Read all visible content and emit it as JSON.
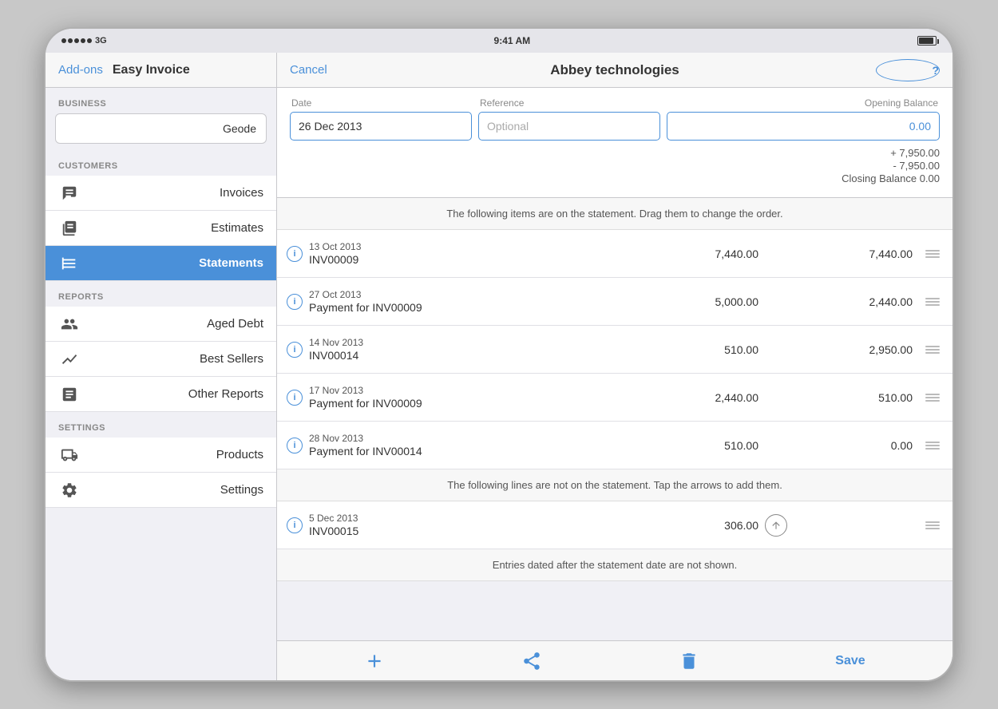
{
  "statusBar": {
    "signal": "●●●●●",
    "network": "3G",
    "time": "9:41 AM"
  },
  "sidebar": {
    "addonsLabel": "Add-ons",
    "appTitle": "Easy Invoice",
    "sections": {
      "business": {
        "label": "BUSINESS",
        "currentBusiness": "Geode"
      },
      "customers": {
        "label": "CUSTOMERS",
        "items": [
          {
            "id": "invoices",
            "label": "Invoices"
          },
          {
            "id": "estimates",
            "label": "Estimates"
          },
          {
            "id": "statements",
            "label": "Statements",
            "active": true
          }
        ]
      },
      "reports": {
        "label": "REPORTS",
        "items": [
          {
            "id": "aged-debt",
            "label": "Aged Debt"
          },
          {
            "id": "best-sellers",
            "label": "Best Sellers"
          },
          {
            "id": "other-reports",
            "label": "Other Reports"
          }
        ]
      },
      "settings": {
        "label": "SETTINGS",
        "items": [
          {
            "id": "products",
            "label": "Products"
          },
          {
            "id": "settings",
            "label": "Settings"
          }
        ]
      }
    }
  },
  "header": {
    "cancelLabel": "Cancel",
    "title": "Abbey technologies",
    "helpLabel": "?"
  },
  "form": {
    "dateLabel": "Date",
    "dateValue": "26 Dec 2013",
    "referenceLabel": "Reference",
    "referencePlaceholder": "Optional",
    "balanceLabel": "Opening Balance",
    "balanceValue": "0.00",
    "addedAmount": "+ 7,950.00",
    "subtractedAmount": "- 7,950.00",
    "closingBalance": "Closing Balance 0.00"
  },
  "statementSection": {
    "onStatementInfo": "The following items are on the statement. Drag them to change the order.",
    "items": [
      {
        "date": "13 Oct 2013",
        "ref": "INV00009",
        "amount": "7,440.00",
        "balance": "7,440.00"
      },
      {
        "date": "27 Oct 2013",
        "ref": "Payment for INV00009",
        "amount": "5,000.00",
        "balance": "2,440.00"
      },
      {
        "date": "14 Nov 2013",
        "ref": "INV00014",
        "amount": "510.00",
        "balance": "2,950.00"
      },
      {
        "date": "17 Nov 2013",
        "ref": "Payment for INV00009",
        "amount": "2,440.00",
        "balance": "510.00"
      },
      {
        "date": "28 Nov 2013",
        "ref": "Payment for INV00014",
        "amount": "510.00",
        "balance": "0.00"
      }
    ],
    "notOnStatementInfo": "The following lines are not on the statement. Tap the arrows to add them.",
    "notOnStatementItems": [
      {
        "date": "5 Dec 2013",
        "ref": "INV00015",
        "amount": "306.00"
      }
    ],
    "afterDateInfo": "Entries dated after the statement date are not shown."
  },
  "toolbar": {
    "addLabel": "+",
    "saveLabel": "Save"
  }
}
